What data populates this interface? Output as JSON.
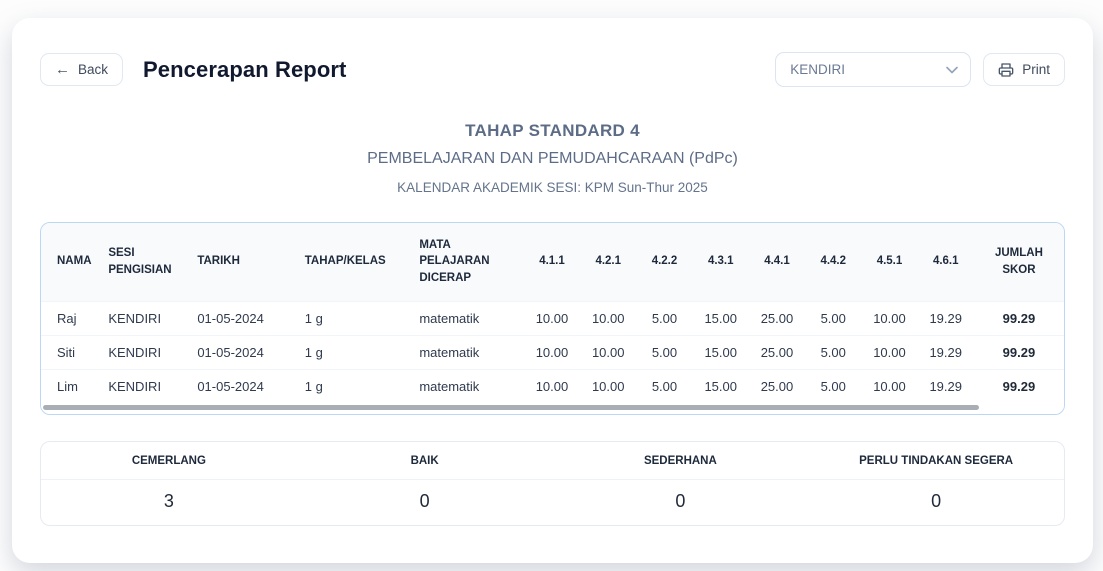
{
  "header": {
    "back_label": "Back",
    "title": "Pencerapan Report",
    "filter_selected": "KENDIRI",
    "print_label": "Print"
  },
  "report": {
    "title": "TAHAP STANDARD 4",
    "subtitle": "PEMBELAJARAN DAN PEMUDAHCARAAN (PdPc)",
    "calendar": "KALENDAR AKADEMIK SESI: KPM Sun-Thur 2025"
  },
  "table": {
    "columns": [
      "NAMA",
      "SESI\nPENGISIAN",
      "TARIKH",
      "TAHAP/KELAS",
      "MATA\nPELAJARAN\nDICERAP",
      "4.1.1",
      "4.2.1",
      "4.2.2",
      "4.3.1",
      "4.4.1",
      "4.4.2",
      "4.5.1",
      "4.6.1",
      "JUMLAH\nSKOR"
    ],
    "rows": [
      [
        "Raj",
        "KENDIRI",
        "01-05-2024",
        "1 g",
        "matematik",
        "10.00",
        "10.00",
        "5.00",
        "15.00",
        "25.00",
        "5.00",
        "10.00",
        "19.29",
        "99.29"
      ],
      [
        "Siti",
        "KENDIRI",
        "01-05-2024",
        "1 g",
        "matematik",
        "10.00",
        "10.00",
        "5.00",
        "15.00",
        "25.00",
        "5.00",
        "10.00",
        "19.29",
        "99.29"
      ],
      [
        "Lim",
        "KENDIRI",
        "01-05-2024",
        "1 g",
        "matematik",
        "10.00",
        "10.00",
        "5.00",
        "15.00",
        "25.00",
        "5.00",
        "10.00",
        "19.29",
        "99.29"
      ]
    ]
  },
  "summary": {
    "columns": [
      "CEMERLANG",
      "BAIK",
      "SEDERHANA",
      "PERLU TINDAKAN SEGERA"
    ],
    "values": [
      "3",
      "0",
      "0",
      "0"
    ]
  },
  "colors": {
    "table_border": "#bcd6f5",
    "summary_border": "#e7eaf0",
    "heading_muted": "#5d6c86",
    "title_dark": "#10192e",
    "header_bg": "#f8fafc",
    "scroll_thumb": "#a9aeb6"
  }
}
